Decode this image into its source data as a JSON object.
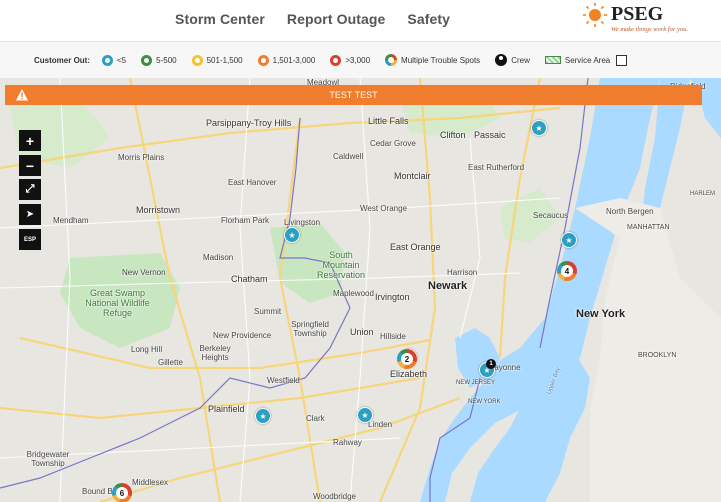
{
  "nav": {
    "items": [
      "Storm Center",
      "Report Outage",
      "Safety"
    ]
  },
  "logo": {
    "name": "PSEG",
    "tagline": "We make things work for you."
  },
  "legend": {
    "title": "Customer Out:",
    "items": [
      {
        "label": "<5",
        "color": "#2aa0c2"
      },
      {
        "label": "5-500",
        "color": "#3e8e41"
      },
      {
        "label": "501-1,500",
        "color": "#f4c430"
      },
      {
        "label": "1,501-3,000",
        "color": "#ef7d2d"
      },
      {
        "label": ">3,000",
        "color": "#d9412a"
      }
    ],
    "multiple": "Multiple Trouble Spots",
    "crew": "Crew",
    "service_area": "Service Area"
  },
  "banner": {
    "text": "TEST TEST"
  },
  "controls": {
    "zoom_in": "+",
    "zoom_out": "−",
    "fullscreen": "⤢",
    "locate": "➤",
    "lang": "ESP"
  },
  "places": {
    "parsippany": "Parsippany-Troy Hills",
    "little_falls": "Little Falls",
    "clifton": "Clifton",
    "passaic": "Passaic",
    "morris_plains": "Morris Plains",
    "caldwell": "Caldwell",
    "cedar_grove": "Cedar Grove",
    "east_hanover": "East Hanover",
    "montclair": "Montclair",
    "east_rutherford": "East Rutherford",
    "mendham": "Mendham",
    "morristown": "Morristown",
    "florham_park": "Florham Park",
    "livingston": "Livingston",
    "west_orange": "West Orange",
    "secaucus": "Secaucus",
    "north_bergen": "North Bergen",
    "manhattan": "MANHATTAN",
    "madison": "Madison",
    "east_orange": "East Orange",
    "south_mountain": "South Mountain Reservation",
    "new_vernon": "New Vernon",
    "chatham": "Chatham",
    "harrison": "Harrison",
    "newark": "Newark",
    "maplewood": "Maplewood",
    "great_swamp": "Great Swamp National Wildlife Refuge",
    "irvington": "Irvington",
    "summit": "Summit",
    "springfield": "Springfield Township",
    "new_york": "New York",
    "new_providence": "New Providence",
    "union": "Union",
    "hillside": "Hillside",
    "long_hill": "Long Hill",
    "berkeley_heights": "Berkeley Heights",
    "gillette": "Gillette",
    "brooklyn": "BROOKLYN",
    "elizabeth": "Elizabeth",
    "westfield": "Westfield",
    "bayonne": "Bayonne",
    "new_jersey": "NEW JERSEY",
    "new_york_state": "NEW YORK",
    "plainfield": "Plainfield",
    "clark": "Clark",
    "linden": "Linden",
    "rahway": "Rahway",
    "bridgewater": "Bridgewater Township",
    "middlesex": "Middlesex",
    "bound_brook": "Bound Brook",
    "woodbridge": "Woodbridge",
    "meadowlands": "Meadowl",
    "upper_bay": "Upper Bay",
    "ridgefield": "Ridgefield",
    "harlem": "HARLEM"
  },
  "clusters": [
    "4",
    "2",
    "6"
  ],
  "crew_count": "1"
}
